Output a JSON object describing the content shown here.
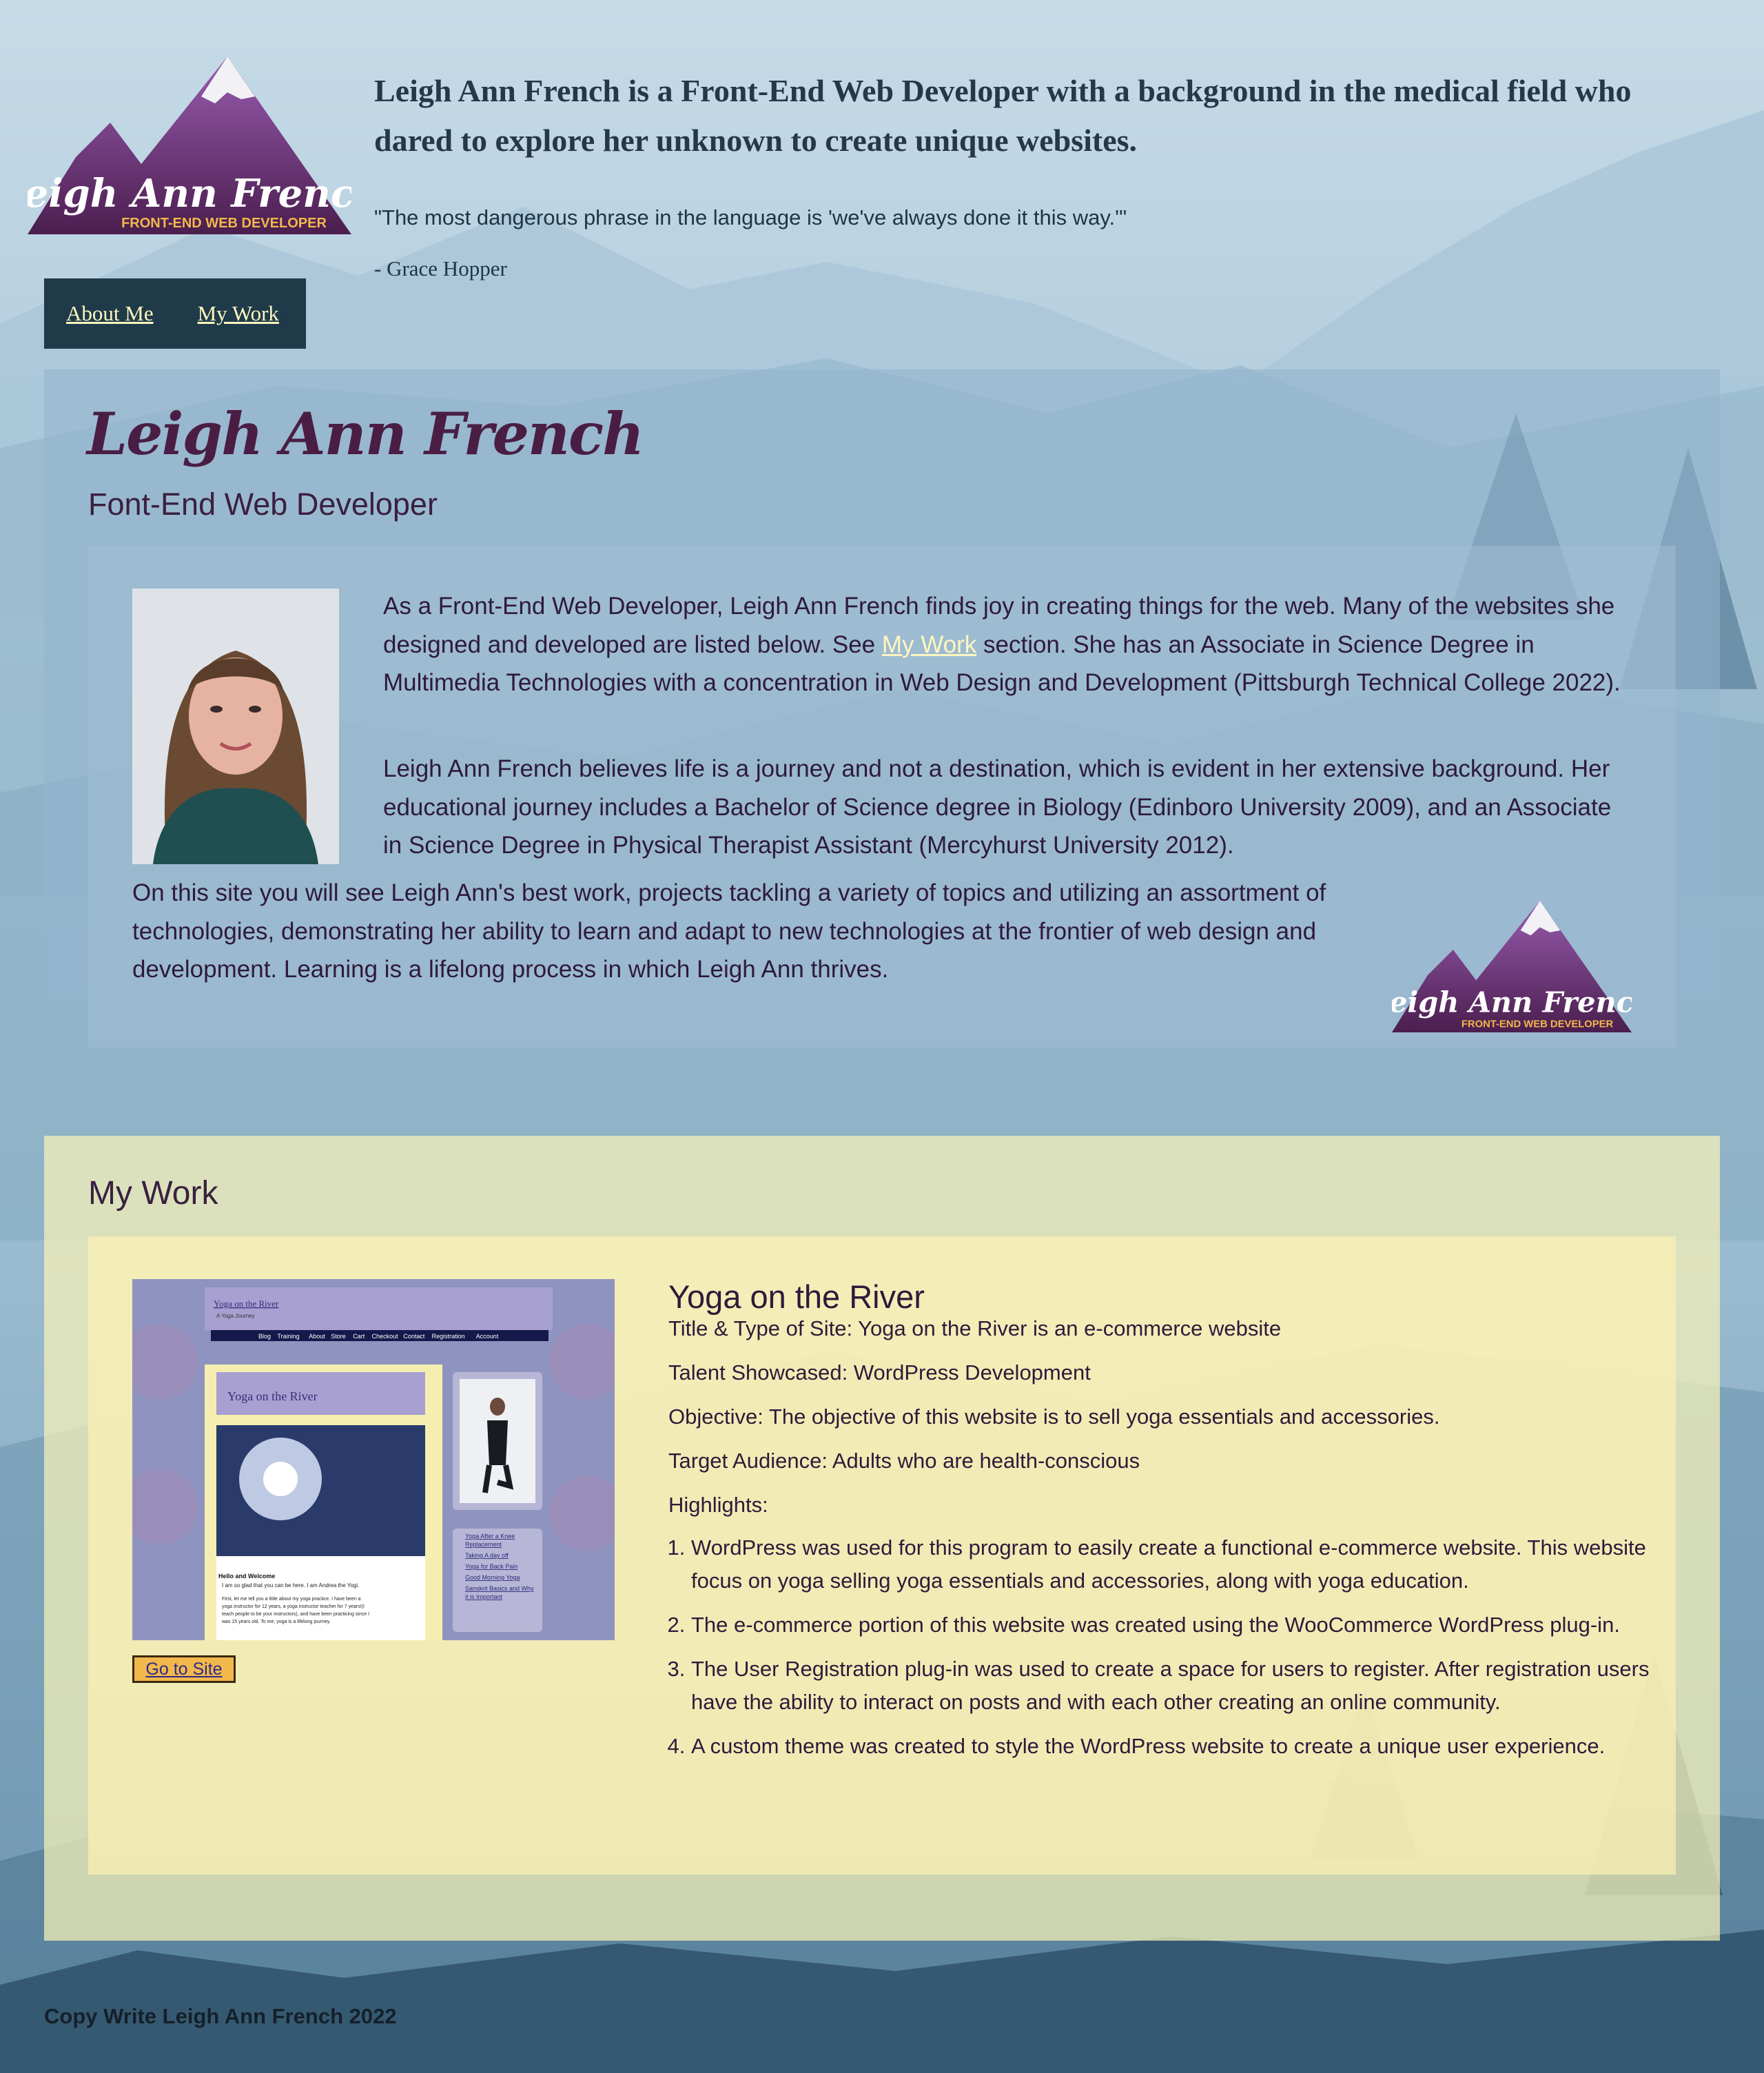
{
  "header": {
    "logo_script": "Leigh Ann French",
    "logo_sub": "FRONT-END WEB DEVELOPER",
    "tagline": "Leigh Ann French is a Front-End Web Developer with a background in the medical field who dared to explore her unknown to create unique websites.",
    "quote": "\"The most dangerous phrase in the language is 'we've always done it this way.'\"",
    "quote_author": "- Grace Hopper"
  },
  "nav": {
    "items": [
      "About Me",
      "My Work"
    ]
  },
  "about": {
    "name": "Leigh Ann French",
    "subtitle": "Font-End Web Developer",
    "p1_before": "As a Front-End Web Developer, Leigh Ann French finds joy in creating things for the web. Many of the websites she designed and developed are listed below. See ",
    "p1_link": "My Work",
    "p1_after": " section. She has an Associate in Science Degree in Multimedia Technologies with a concentration in Web Design and Development (Pittsburgh Technical College 2022).",
    "p2": "Leigh Ann French believes life is a journey and not a destination, which is evident in her extensive background. Her educational journey includes a Bachelor of Science degree in Biology (Edinboro University 2009), and an Associate in Science Degree in Physical Therapist Assistant (Mercyhurst University 2012).",
    "p3": "On this site you will see Leigh Ann's best work, projects tackling a variety of topics and utilizing an assortment of technologies, demonstrating her ability to learn and adapt to new technologies at the frontier of web design and development. Learning is a lifelong process in which Leigh Ann thrives."
  },
  "work": {
    "title": "My Work",
    "project": {
      "name": "Yoga on the River",
      "button": "Go to Site",
      "title_type": "Title & Type of Site: Yoga on the River is an e-commerce website",
      "talent": "Talent Showcased: WordPress Development",
      "objective": "Objective: The objective of this website is to sell yoga essentials and accessories.",
      "audience": "Target Audience: Adults who are health-conscious",
      "highlights_label": "Highlights:",
      "highlights": [
        "WordPress was used for this program to easily create a functional e-commerce website. This website focus on yoga selling yoga essentials and accessories, along with yoga education.",
        "The e-commerce portion of this website was created using the WooCommerce WordPress plug-in.",
        "The User Registration plug-in was used to create a space for users to register. After registration users have the ability to interact on posts and with each other creating an online community.",
        "A custom theme was created to style the WordPress website to create a unique user experience."
      ],
      "screenshot": {
        "site_title": "Yoga on the River",
        "site_tagline": "A Yoga Journey",
        "menu": [
          "Blog",
          "Training",
          "About",
          "Store",
          "Cart",
          "Checkout",
          "Contact",
          "Registration",
          "Account"
        ],
        "post_title": "Yoga on the River",
        "hello_heading": "Hello and Welcome",
        "intro": "I am so glad that you can be here. I am Andrea the Yogi.",
        "body": [
          "First, let me tell you a little about my yoga practice. I have been a",
          "yoga instructor for 12 years, a yoga instructor teacher for 7 years!(I",
          "teach people to be your instructors), and have been practicing since I",
          "was 15 years old. To me, yoga is a lifelong journey."
        ],
        "sidebar_links": [
          "Yoga After a Knee",
          "Replacement",
          "Taking A day off",
          "Yoga for Back Pain",
          "Good Morning Yoga",
          "Sanskrit Basics and Why",
          "it is Important"
        ]
      }
    }
  },
  "footer": {
    "text": "Copy Write Leigh Ann French 2022"
  },
  "colors": {
    "nav_bg": "#1f3a48",
    "link": "#fff6c0",
    "name_purple": "#4a1e44",
    "logo_purple": "#7a3f8e",
    "button": "#f2b84b"
  }
}
